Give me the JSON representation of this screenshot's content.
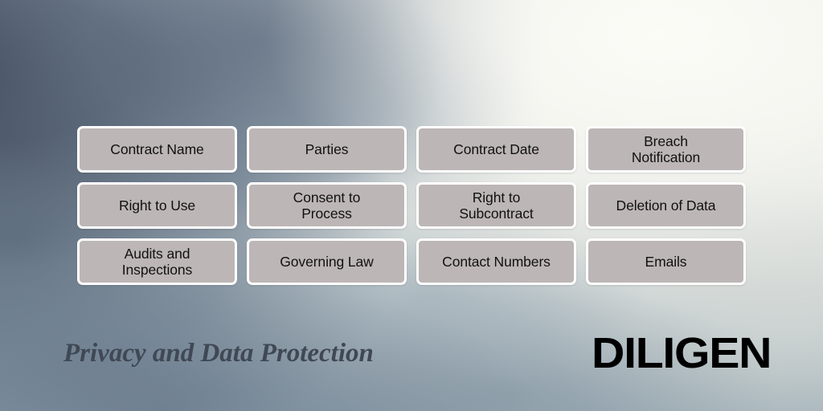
{
  "slide": {
    "title": "Privacy and Data Protection",
    "brand": "DILIGEN",
    "title_color": "#3f4854",
    "brand_color": "#000000",
    "tile_fill_color": "#bdb6b6",
    "tile_border_color": "#ffffff",
    "tile_text_color": "#111111"
  },
  "grid": {
    "columns": 4,
    "rows": 3,
    "tiles": [
      {
        "label": "Contract Name"
      },
      {
        "label": "Parties"
      },
      {
        "label": "Contract Date"
      },
      {
        "label": "Breach\nNotification"
      },
      {
        "label": "Right to Use"
      },
      {
        "label": "Consent to\nProcess"
      },
      {
        "label": "Right to\nSubcontract"
      },
      {
        "label": "Deletion of Data"
      },
      {
        "label": "Audits and\nInspections"
      },
      {
        "label": "Governing Law"
      },
      {
        "label": "Contact Numbers"
      },
      {
        "label": "Emails"
      }
    ]
  }
}
